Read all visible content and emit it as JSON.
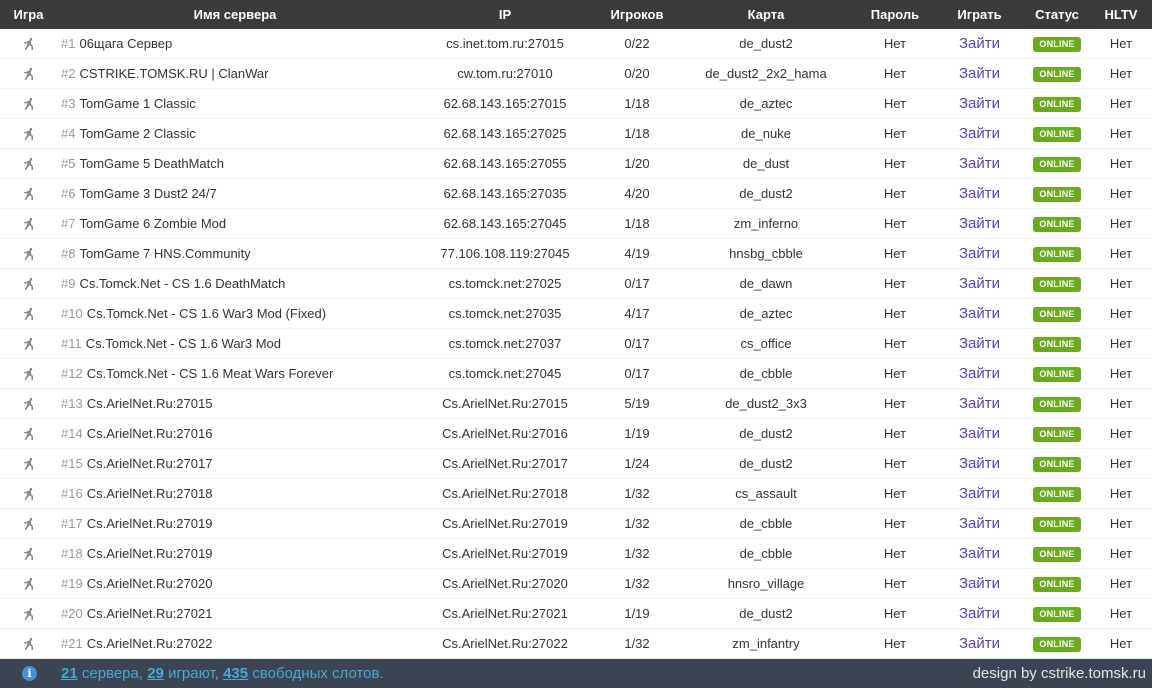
{
  "header": {
    "game": "Игра",
    "name": "Имя сервера",
    "ip": "IP",
    "players": "Игроков",
    "map": "Карта",
    "password": "Пароль",
    "play": "Играть",
    "status": "Статус",
    "hltv": "HLTV"
  },
  "servers": [
    {
      "num": "#1",
      "name": "06щага Сервер",
      "ip": "cs.inet.tom.ru:27015",
      "players": "0/22",
      "map": "de_dust2",
      "password": "Нет",
      "play": "Зайти",
      "status": "ONLINE",
      "hltv": "Нет"
    },
    {
      "num": "#2",
      "name": "CSTRIKE.TOMSK.RU | ClanWar",
      "ip": "cw.tom.ru:27010",
      "players": "0/20",
      "map": "de_dust2_2x2_hama",
      "password": "Нет",
      "play": "Зайти",
      "status": "ONLINE",
      "hltv": "Нет"
    },
    {
      "num": "#3",
      "name": "TomGame 1 Classic",
      "ip": "62.68.143.165:27015",
      "players": "1/18",
      "map": "de_aztec",
      "password": "Нет",
      "play": "Зайти",
      "status": "ONLINE",
      "hltv": "Нет"
    },
    {
      "num": "#4",
      "name": "TomGame 2 Classic",
      "ip": "62.68.143.165:27025",
      "players": "1/18",
      "map": "de_nuke",
      "password": "Нет",
      "play": "Зайти",
      "status": "ONLINE",
      "hltv": "Нет"
    },
    {
      "num": "#5",
      "name": "TomGame 5 DeathMatch",
      "ip": "62.68.143.165:27055",
      "players": "1/20",
      "map": "de_dust",
      "password": "Нет",
      "play": "Зайти",
      "status": "ONLINE",
      "hltv": "Нет"
    },
    {
      "num": "#6",
      "name": "TomGame 3 Dust2 24/7",
      "ip": "62.68.143.165:27035",
      "players": "4/20",
      "map": "de_dust2",
      "password": "Нет",
      "play": "Зайти",
      "status": "ONLINE",
      "hltv": "Нет"
    },
    {
      "num": "#7",
      "name": "TomGame 6 Zombie Mod",
      "ip": "62.68.143.165:27045",
      "players": "1/18",
      "map": "zm_inferno",
      "password": "Нет",
      "play": "Зайти",
      "status": "ONLINE",
      "hltv": "Нет"
    },
    {
      "num": "#8",
      "name": "TomGame 7 HNS.Community",
      "ip": "77.106.108.119:27045",
      "players": "4/19",
      "map": "hnsbg_cbble",
      "password": "Нет",
      "play": "Зайти",
      "status": "ONLINE",
      "hltv": "Нет"
    },
    {
      "num": "#9",
      "name": "Cs.Tomck.Net - CS 1.6 DeathMatch",
      "ip": "cs.tomck.net:27025",
      "players": "0/17",
      "map": "de_dawn",
      "password": "Нет",
      "play": "Зайти",
      "status": "ONLINE",
      "hltv": "Нет"
    },
    {
      "num": "#10",
      "name": "Cs.Tomck.Net - CS 1.6 War3 Mod (Fixed)",
      "ip": "cs.tomck.net:27035",
      "players": "4/17",
      "map": "de_aztec",
      "password": "Нет",
      "play": "Зайти",
      "status": "ONLINE",
      "hltv": "Нет"
    },
    {
      "num": "#11",
      "name": "Cs.Tomck.Net - CS 1.6 War3 Mod",
      "ip": "cs.tomck.net:27037",
      "players": "0/17",
      "map": "cs_office",
      "password": "Нет",
      "play": "Зайти",
      "status": "ONLINE",
      "hltv": "Нет"
    },
    {
      "num": "#12",
      "name": "Cs.Tomck.Net - CS 1.6 Meat Wars Forever",
      "ip": "cs.tomck.net:27045",
      "players": "0/17",
      "map": "de_cbble",
      "password": "Нет",
      "play": "Зайти",
      "status": "ONLINE",
      "hltv": "Нет"
    },
    {
      "num": "#13",
      "name": "Cs.ArielNet.Ru:27015",
      "ip": "Cs.ArielNet.Ru:27015",
      "players": "5/19",
      "map": "de_dust2_3x3",
      "password": "Нет",
      "play": "Зайти",
      "status": "ONLINE",
      "hltv": "Нет"
    },
    {
      "num": "#14",
      "name": "Cs.ArielNet.Ru:27016",
      "ip": "Cs.ArielNet.Ru:27016",
      "players": "1/19",
      "map": "de_dust2",
      "password": "Нет",
      "play": "Зайти",
      "status": "ONLINE",
      "hltv": "Нет"
    },
    {
      "num": "#15",
      "name": "Cs.ArielNet.Ru:27017",
      "ip": "Cs.ArielNet.Ru:27017",
      "players": "1/24",
      "map": "de_dust2",
      "password": "Нет",
      "play": "Зайти",
      "status": "ONLINE",
      "hltv": "Нет"
    },
    {
      "num": "#16",
      "name": "Cs.ArielNet.Ru:27018",
      "ip": "Cs.ArielNet.Ru:27018",
      "players": "1/32",
      "map": "cs_assault",
      "password": "Нет",
      "play": "Зайти",
      "status": "ONLINE",
      "hltv": "Нет"
    },
    {
      "num": "#17",
      "name": "Cs.ArielNet.Ru:27019",
      "ip": "Cs.ArielNet.Ru:27019",
      "players": "1/32",
      "map": "de_cbble",
      "password": "Нет",
      "play": "Зайти",
      "status": "ONLINE",
      "hltv": "Нет"
    },
    {
      "num": "#18",
      "name": "Cs.ArielNet.Ru:27019",
      "ip": "Cs.ArielNet.Ru:27019",
      "players": "1/32",
      "map": "de_cbble",
      "password": "Нет",
      "play": "Зайти",
      "status": "ONLINE",
      "hltv": "Нет"
    },
    {
      "num": "#19",
      "name": "Cs.ArielNet.Ru:27020",
      "ip": "Cs.ArielNet.Ru:27020",
      "players": "1/32",
      "map": "hnsro_village",
      "password": "Нет",
      "play": "Зайти",
      "status": "ONLINE",
      "hltv": "Нет"
    },
    {
      "num": "#20",
      "name": "Cs.ArielNet.Ru:27021",
      "ip": "Cs.ArielNet.Ru:27021",
      "players": "1/19",
      "map": "de_dust2",
      "password": "Нет",
      "play": "Зайти",
      "status": "ONLINE",
      "hltv": "Нет"
    },
    {
      "num": "#21",
      "name": "Cs.ArielNet.Ru:27022",
      "ip": "Cs.ArielNet.Ru:27022",
      "players": "1/32",
      "map": "zm_infantry",
      "password": "Нет",
      "play": "Зайти",
      "status": "ONLINE",
      "hltv": "Нет"
    }
  ],
  "footer": {
    "info_icon": "info-icon",
    "servers_count": "21",
    "servers_word": "сервера,",
    "playing_count": "29",
    "playing_word": "играют,",
    "free_count": "435",
    "free_word": "свободных слотов.",
    "design": "design by cstrike.tomsk.ru"
  },
  "colors": {
    "header_bg": "#3b3b3b",
    "footer_bg": "#3a4452",
    "status_badge": "#6bab1f",
    "play_link": "#5a3fc0",
    "stats_text": "#4aa9d8"
  },
  "icons": {
    "game": "counter-strike-icon"
  }
}
